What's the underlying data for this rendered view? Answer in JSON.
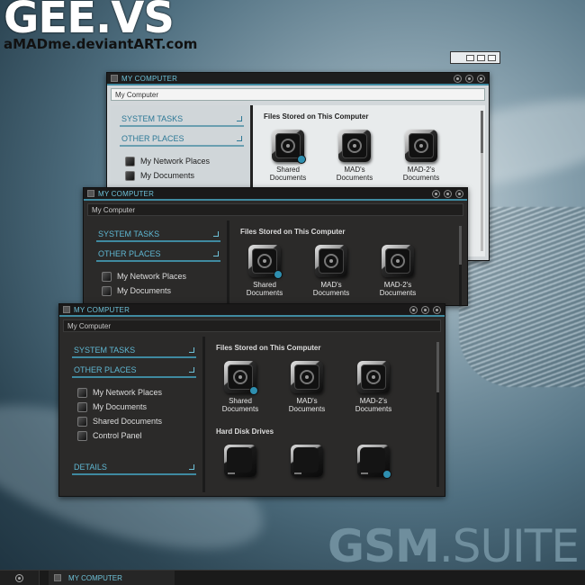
{
  "brand": {
    "title": "GEE.VS",
    "credit_prefix": "aMADme",
    "credit_suffix": ".deviantART.com"
  },
  "watermark": {
    "main": "GSM",
    "suffix": ".SUITE"
  },
  "explorer": {
    "window_title": "MY COMPUTER",
    "address": "My Computer",
    "system_tasks": "SYSTEM TASKS",
    "other_places": "OTHER PLACES",
    "details": "DETAILS",
    "places": [
      "My Network Places",
      "My Documents",
      "Shared Documents",
      "Control Panel"
    ],
    "files_header": "Files Stored on This Computer",
    "files": [
      "Shared Documents",
      "MAD's Documents",
      "MAD-2's Documents"
    ],
    "drives_header": "Hard Disk Drives"
  },
  "taskbar": {
    "task_label": "MY COMPUTER"
  },
  "colors": {
    "accent": "#3f8aa0",
    "accent_text": "#5fb7d2",
    "dark_bg": "#2b2a29",
    "light_bg": "#d2d7da"
  },
  "icons": {
    "title": "computer-icon",
    "buttons": [
      "minimize-icon",
      "maximize-icon",
      "close-icon"
    ],
    "places": [
      "network-icon",
      "documents-icon",
      "shared-documents-icon",
      "control-panel-icon"
    ],
    "files": "folder-icon",
    "drives": "hard-drive-icon"
  }
}
